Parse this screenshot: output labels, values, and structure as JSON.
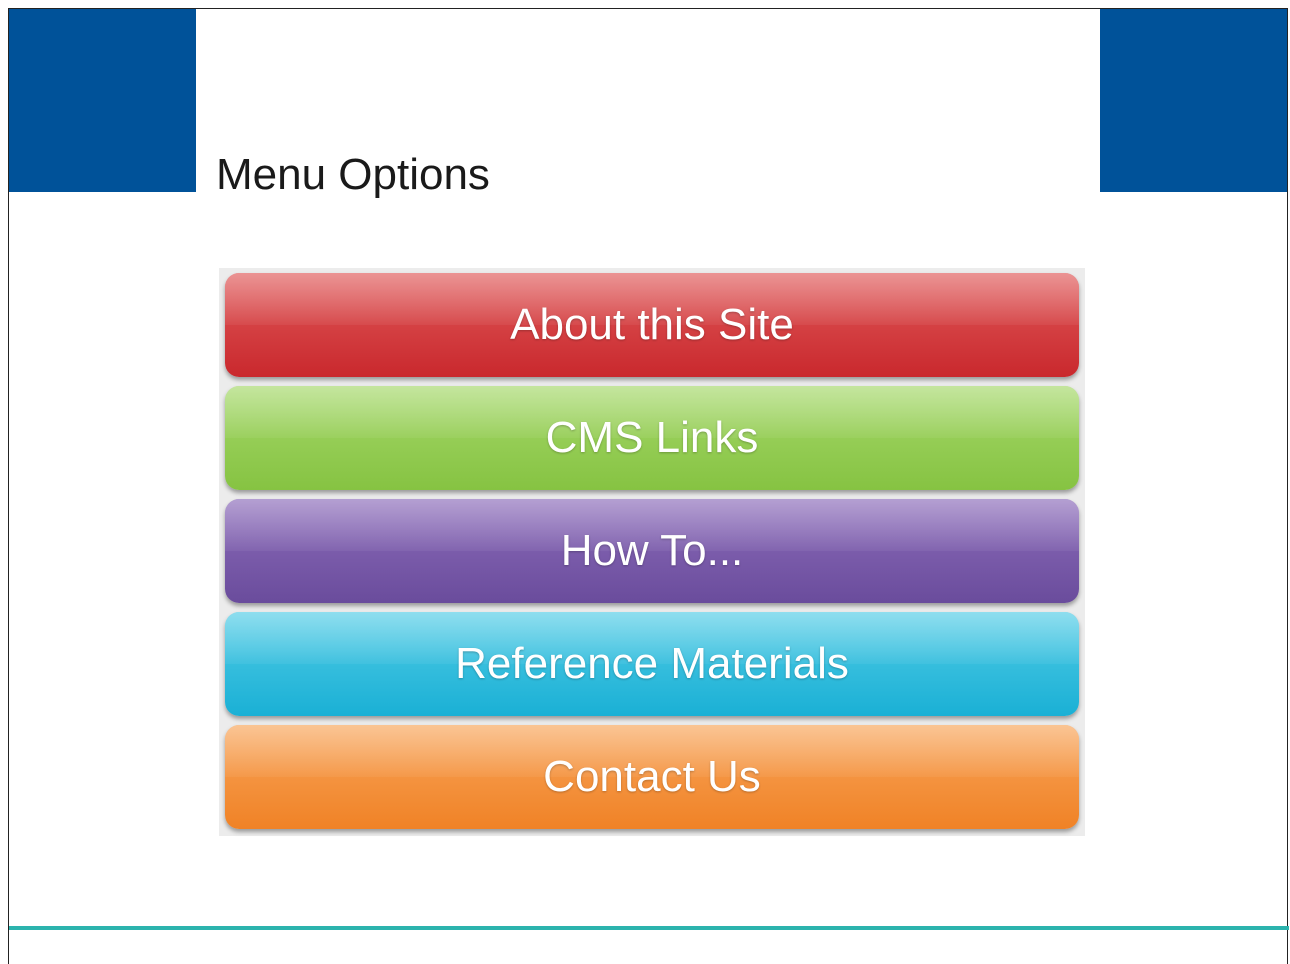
{
  "slide": {
    "title": "Menu Options"
  },
  "colors": {
    "header_block": "#005299",
    "bottom_rule": "#2bb3ad"
  },
  "menu": {
    "items": [
      {
        "label": "About this Site",
        "color_top": "#e05a5a",
        "color_bottom": "#c9282d"
      },
      {
        "label": "CMS Links",
        "color_top": "#a5d86a",
        "color_bottom": "#86c342"
      },
      {
        "label": "How To...",
        "color_top": "#8c6cba",
        "color_bottom": "#6a4c9c"
      },
      {
        "label": "Reference Materials",
        "color_top": "#52cce6",
        "color_bottom": "#1ab0d5"
      },
      {
        "label": "Contact Us",
        "color_top": "#f8a55a",
        "color_bottom": "#f08226"
      }
    ]
  }
}
